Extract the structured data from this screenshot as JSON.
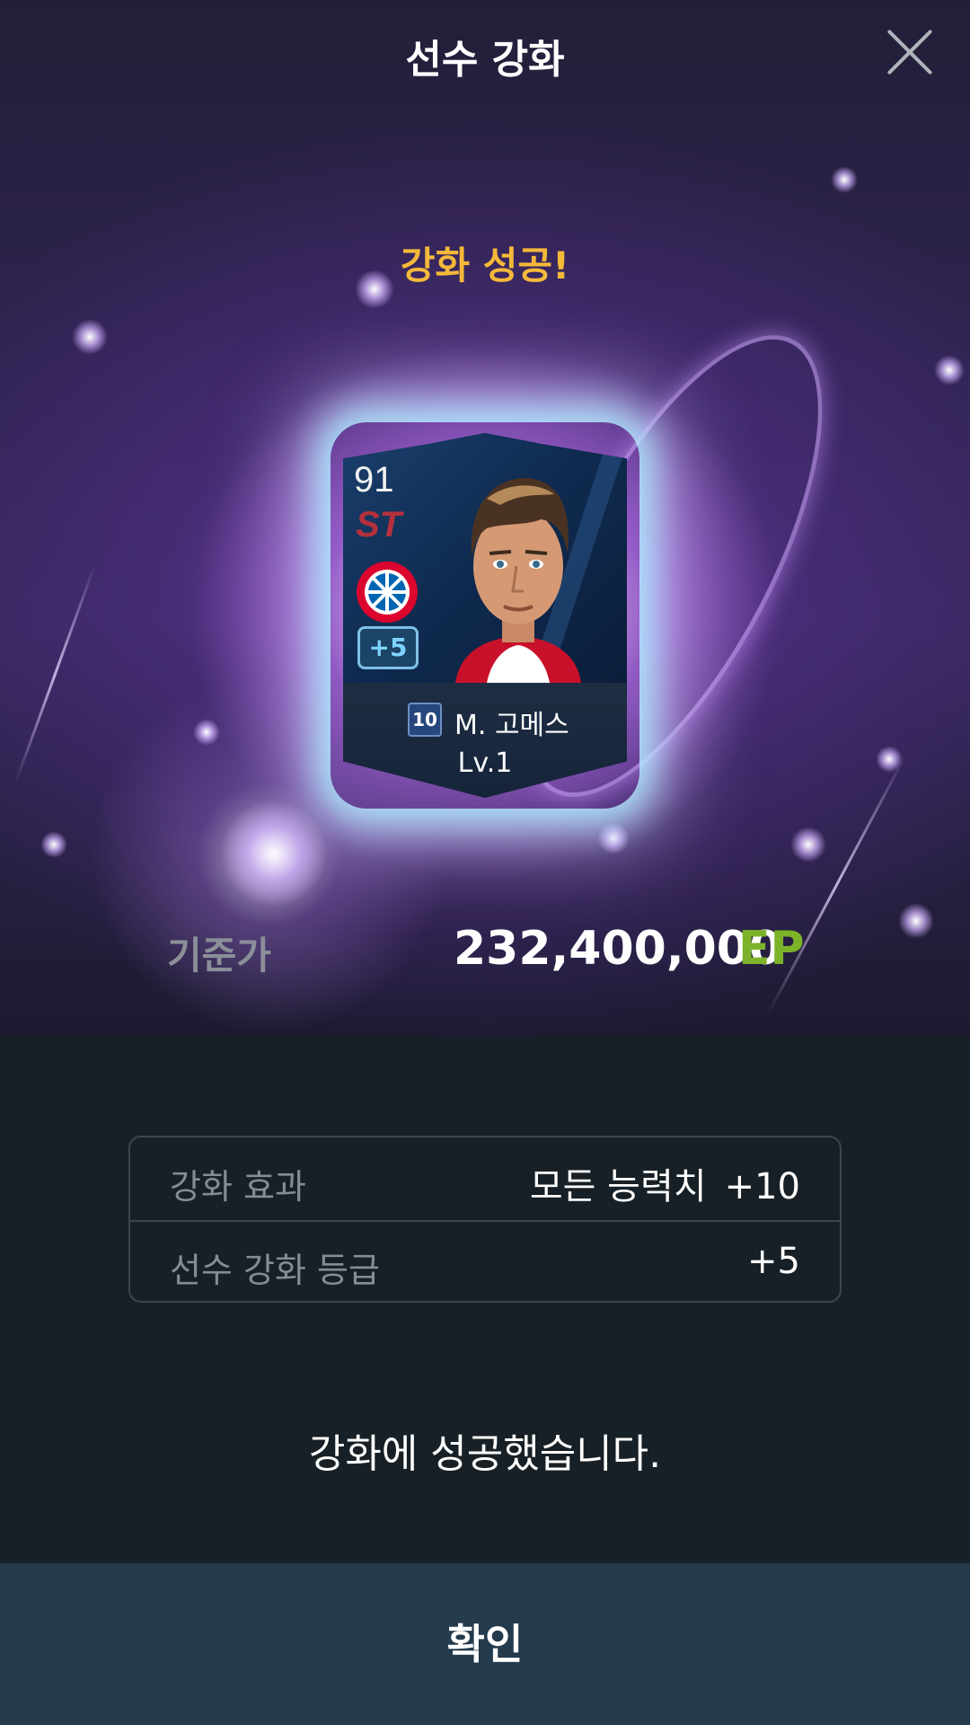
{
  "header": {
    "title": "선수 강화",
    "close_icon": "close-icon"
  },
  "result": {
    "headline": "강화 성공!",
    "headline_color": "#f5b93a"
  },
  "player_card": {
    "rating": "91",
    "position": "ST",
    "club_logo": "bayern-munich-logo",
    "upgrade_badge": "+5",
    "jersey_number": "10",
    "name": "M. 고메스",
    "level": "Lv.1"
  },
  "base_price": {
    "label": "기준가",
    "value": "232,400,000",
    "unit": "EP",
    "unit_color": "#7cb32a"
  },
  "upgrade_info": {
    "rows": [
      {
        "label": "강화 효과",
        "value": "모든 능력치",
        "delta": "+10"
      },
      {
        "label": "선수 강화 등급",
        "value": "",
        "delta": "+5"
      }
    ]
  },
  "message": "강화에 성공했습니다.",
  "confirm_button": {
    "label": "확인"
  }
}
